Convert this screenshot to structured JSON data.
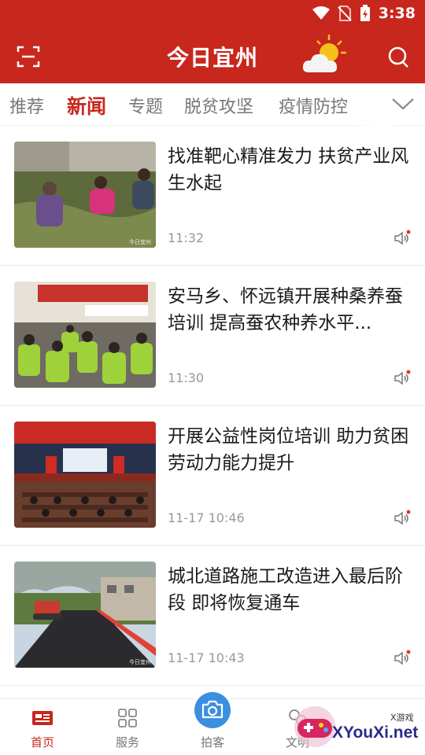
{
  "status_bar": {
    "time": "3:38"
  },
  "app_bar": {
    "title": "今日宜州"
  },
  "tabs": [
    {
      "label": "推荐",
      "active": false
    },
    {
      "label": "新闻",
      "active": true
    },
    {
      "label": "专题",
      "active": false
    },
    {
      "label": "脱贫攻坚",
      "active": false
    },
    {
      "label": "疫情防控",
      "active": false
    }
  ],
  "news": [
    {
      "title": "找准靶心精准发力 扶贫产业风生水起",
      "time": "11:32",
      "thumb_mark": "今日宜州"
    },
    {
      "title": "安马乡、怀远镇开展种桑养蚕培训 提高蚕农种养水平...",
      "time": "11:30"
    },
    {
      "title": "开展公益性岗位培训 助力贫困劳动力能力提升",
      "time": "11-17 10:46"
    },
    {
      "title": "城北道路施工改造进入最后阶段 即将恢复通车",
      "time": "11-17 10:43",
      "thumb_mark": "今日宜州"
    }
  ],
  "bottom_nav": [
    {
      "label": "首页",
      "active": true
    },
    {
      "label": "服务",
      "active": false
    },
    {
      "label": "拍客",
      "active": false
    },
    {
      "label": "文明",
      "active": false
    }
  ],
  "watermark": {
    "brand": "XYouXi.net",
    "small": "X游戏"
  },
  "colors": {
    "brand_red": "#c8271d",
    "camera_blue": "#3b8fe0",
    "text_gray": "#999999"
  }
}
